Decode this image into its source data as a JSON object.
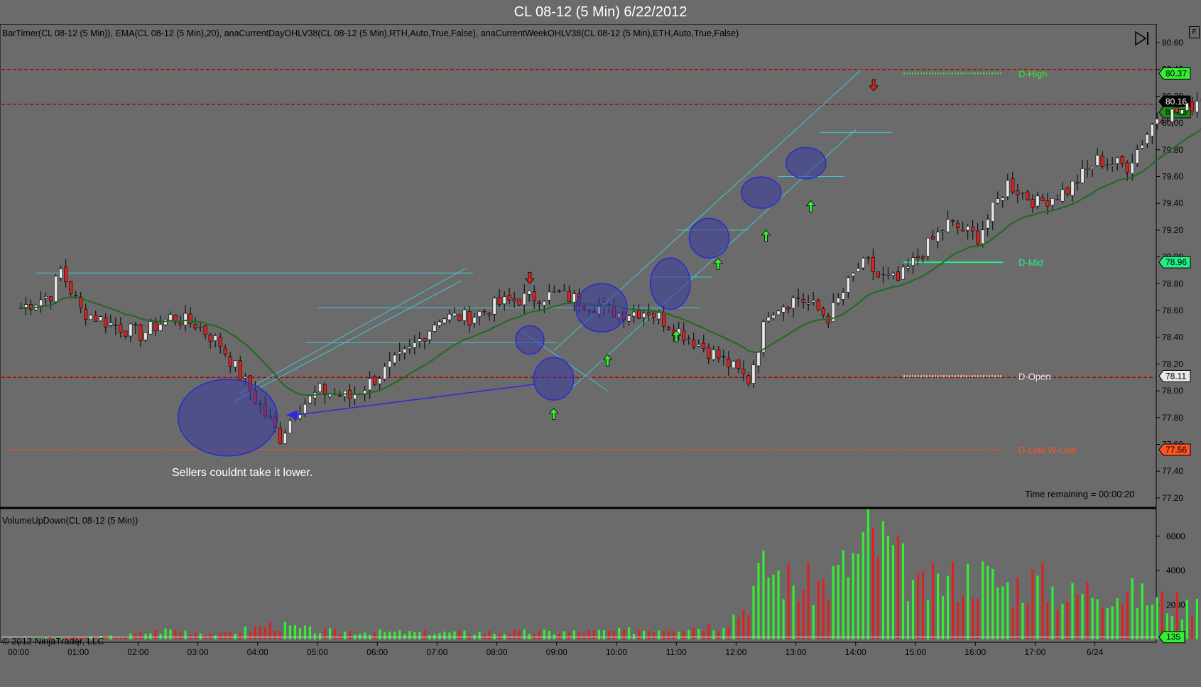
{
  "title": "CL 08-12 (5 Min)  6/22/2012",
  "indicators_label": "BarTimer(CL 08-12 (5 Min)),  EMA(CL 08-12 (5 Min),20),  anaCurrentDayOHLV38(CL 08-12 (5 Min),RTH,Auto,True,False),  anaCurrentWeekOHLV38(CL 08-12 (5 Min),ETH,Auto,True,False)",
  "volume_label": "VolumeUpDown(CL 08-12 (5 Min))",
  "annotation_text": "Sellers couldnt take it lower.",
  "time_remaining": "Time remaining = 00:00:20",
  "copyright": "© 2012 NinjaTrader, LLC",
  "f_button": "F",
  "colors": {
    "background": "#6b6b6b",
    "up_bar": "#33ee33",
    "down_bar": "#dd2222",
    "ema": "#1e6b1e",
    "level_line": "#b00000",
    "trend_line": "#40c8d8",
    "circle_fill": "#3a3aa0",
    "arrow": "#2a2ae0"
  },
  "chart_data": [
    {
      "type": "candlestick",
      "title": "CL 08-12 (5 Min)  6/22/2012",
      "ylim": [
        77.2,
        80.7
      ],
      "y_ticks": [
        "80.60",
        "80.40",
        "80.20",
        "80.00",
        "79.80",
        "79.60",
        "79.40",
        "79.20",
        "79.00",
        "78.80",
        "78.60",
        "78.40",
        "78.20",
        "78.00",
        "77.80",
        "77.60",
        "77.40",
        "77.20"
      ],
      "x_ticks": [
        "00:00",
        "01:00",
        "02:00",
        "03:00",
        "04:00",
        "05:00",
        "06:00",
        "07:00",
        "08:00",
        "09:00",
        "10:00",
        "11:00",
        "12:00",
        "13:00",
        "14:00",
        "15:00",
        "16:00",
        "17:00",
        "6/24"
      ],
      "levels": [
        {
          "name": "D-High",
          "label": "D-High",
          "value": 80.37,
          "value_label": "80.37",
          "color": "#33ee33"
        },
        {
          "name": "current",
          "value": 80.16,
          "value_label": "80.16",
          "color": "#000000"
        },
        {
          "name": "ema",
          "value": 80.08,
          "value_label": "80.08",
          "color": "#1e8b1e"
        },
        {
          "name": "D-Mid",
          "label": "D-Mid",
          "value": 78.96,
          "value_label": "78.96",
          "color": "#22ee88"
        },
        {
          "name": "D-Open",
          "label": "D-Open",
          "value": 78.11,
          "value_label": "78.11",
          "color": "#e8e8e8"
        },
        {
          "name": "D-Low",
          "label": "D-Low   W-Low",
          "value": 77.56,
          "value_label": "77.56",
          "color": "#ff5522"
        }
      ],
      "red_dashed_lines": [
        80.4,
        80.14,
        78.1
      ],
      "anchors": [
        [
          0,
          78.62
        ],
        [
          6,
          78.72
        ],
        [
          8,
          78.9
        ],
        [
          12,
          78.6
        ],
        [
          18,
          78.5
        ],
        [
          24,
          78.42
        ],
        [
          30,
          78.55
        ],
        [
          35,
          78.5
        ],
        [
          40,
          78.35
        ],
        [
          46,
          78.0
        ],
        [
          52,
          77.65
        ],
        [
          55,
          77.85
        ],
        [
          60,
          78.0
        ],
        [
          66,
          77.95
        ],
        [
          72,
          78.12
        ],
        [
          78,
          78.3
        ],
        [
          84,
          78.55
        ],
        [
          90,
          78.55
        ],
        [
          96,
          78.65
        ],
        [
          102,
          78.7
        ],
        [
          108,
          78.72
        ],
        [
          114,
          78.65
        ],
        [
          120,
          78.58
        ],
        [
          126,
          78.6
        ],
        [
          132,
          78.45
        ],
        [
          138,
          78.3
        ],
        [
          142,
          78.2
        ],
        [
          146,
          78.08
        ],
        [
          150,
          78.6
        ],
        [
          156,
          78.7
        ],
        [
          162,
          78.55
        ],
        [
          168,
          78.92
        ],
        [
          170,
          78.95
        ],
        [
          172,
          78.85
        ],
        [
          176,
          78.82
        ],
        [
          180,
          79.0
        ],
        [
          186,
          79.25
        ],
        [
          192,
          79.15
        ],
        [
          198,
          79.55
        ],
        [
          204,
          79.4
        ],
        [
          210,
          79.5
        ],
        [
          216,
          79.72
        ],
        [
          222,
          79.68
        ],
        [
          228,
          80.05
        ],
        [
          234,
          80.1
        ],
        [
          238,
          80.25
        ],
        [
          242,
          79.95
        ],
        [
          246,
          79.68
        ],
        [
          250,
          79.75
        ],
        [
          256,
          79.95
        ],
        [
          262,
          79.95
        ],
        [
          268,
          80.02
        ],
        [
          274,
          80.08
        ],
        [
          280,
          80.18
        ]
      ],
      "circles_x_hours": [
        3.5,
        8.5,
        8.95,
        9.55,
        10.75,
        11.55,
        12.4,
        13.15
      ],
      "up_arrows_hours": [
        8.95,
        9.85,
        11.0,
        11.7,
        12.5,
        13.25
      ],
      "down_arrows_hours": [
        8.55,
        14.3
      ],
      "annotation": "Sellers couldnt take it lower."
    },
    {
      "type": "bar",
      "title": "VolumeUpDown(CL 08-12 (5 Min))",
      "ylim": [
        0,
        7000
      ],
      "y_ticks": [
        "6000",
        "4000",
        "2000"
      ],
      "last_value": 135,
      "last_value_label": "135",
      "volume_anchors": [
        [
          0,
          40
        ],
        [
          20,
          200
        ],
        [
          30,
          600
        ],
        [
          40,
          300
        ],
        [
          50,
          900
        ],
        [
          60,
          500
        ],
        [
          80,
          400
        ],
        [
          100,
          450
        ],
        [
          110,
          450
        ],
        [
          120,
          500
        ],
        [
          130,
          700
        ],
        [
          140,
          850
        ],
        [
          145,
          1900
        ],
        [
          148,
          3800
        ],
        [
          150,
          4400
        ],
        [
          156,
          3200
        ],
        [
          162,
          3500
        ],
        [
          168,
          5200
        ],
        [
          170,
          6200
        ],
        [
          174,
          5600
        ],
        [
          180,
          3000
        ],
        [
          186,
          3600
        ],
        [
          192,
          4000
        ],
        [
          198,
          3200
        ],
        [
          204,
          3600
        ],
        [
          210,
          2600
        ],
        [
          216,
          3200
        ],
        [
          222,
          2800
        ],
        [
          228,
          2400
        ],
        [
          234,
          2000
        ],
        [
          240,
          4500
        ],
        [
          244,
          5100
        ],
        [
          246,
          6900
        ],
        [
          250,
          1500
        ],
        [
          256,
          1100
        ],
        [
          262,
          650
        ],
        [
          268,
          550
        ],
        [
          274,
          400
        ],
        [
          280,
          135
        ]
      ]
    }
  ]
}
